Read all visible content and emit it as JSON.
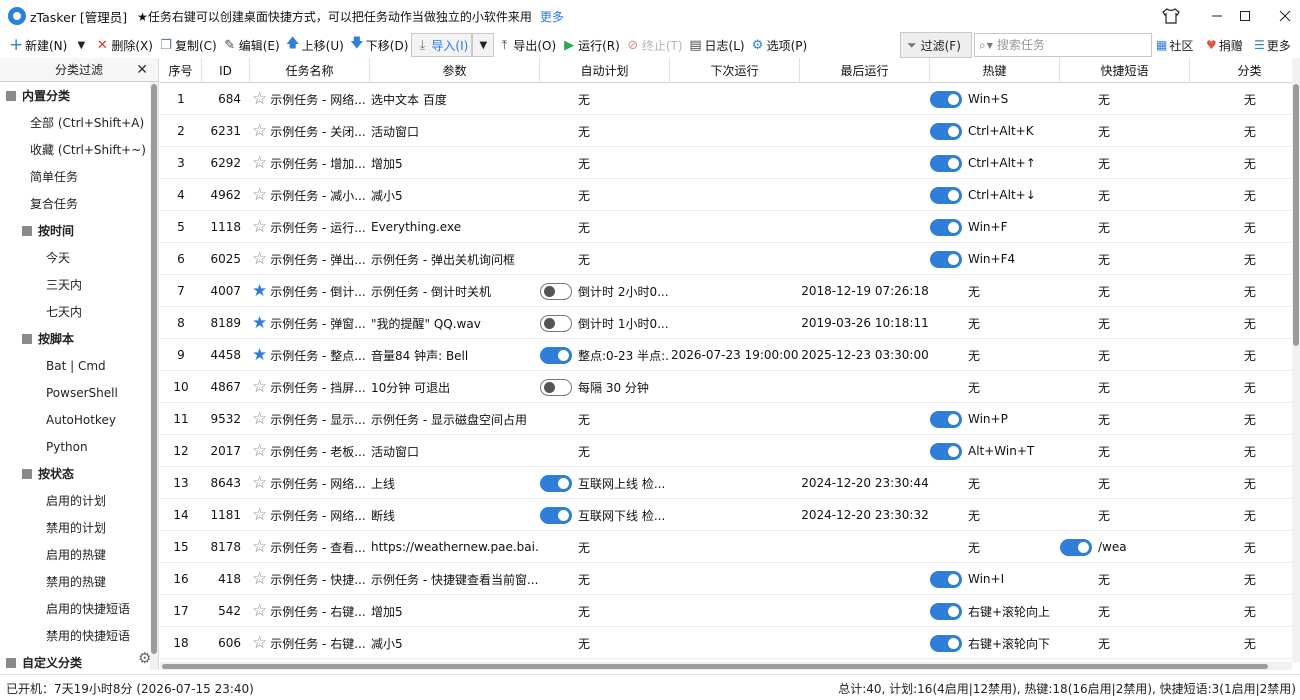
{
  "window": {
    "title": "zTasker [管理员]",
    "tip": "★任务右键可以创建桌面快捷方式，可以把任务动作当做独立的小软件来用",
    "more_link": "更多"
  },
  "toolbar": {
    "new": "新建(N)",
    "delete": "删除(X)",
    "copy": "复制(C)",
    "edit": "编辑(E)",
    "up": "上移(U)",
    "down": "下移(D)",
    "import": "导入(I)",
    "export": "导出(O)",
    "run": "运行(R)",
    "stop": "终止(T)",
    "log": "日志(L)",
    "options": "选项(P)",
    "filter": "过滤(F)",
    "search_placeholder": "搜索任务",
    "community": "社区",
    "donate": "捐赠",
    "more": "更多"
  },
  "sidebar": {
    "header": "分类过滤",
    "groups": [
      {
        "label": "内置分类",
        "items": [
          "全部 (Ctrl+Shift+A)",
          "收藏 (Ctrl+Shift+~)",
          "简单任务",
          "复合任务"
        ]
      },
      {
        "label": "按时间",
        "items": [
          "今天",
          "三天内",
          "七天内"
        ]
      },
      {
        "label": "按脚本",
        "items": [
          "Bat | Cmd",
          "PowserShell",
          "AutoHotkey",
          "Python"
        ]
      },
      {
        "label": "按状态",
        "items": [
          "启用的计划",
          "禁用的计划",
          "启用的热键",
          "禁用的热键",
          "启用的快捷短语",
          "禁用的快捷短语"
        ]
      },
      {
        "label": "自定义分类",
        "items": []
      }
    ]
  },
  "table": {
    "columns": [
      "序号",
      "ID",
      "任务名称",
      "参数",
      "自动计划",
      "下次运行",
      "最后运行",
      "热键",
      "快捷短语",
      "分类"
    ],
    "rows": [
      {
        "no": "1",
        "id": "684",
        "star": false,
        "name": "示例任务 - 网络...",
        "param": "选中文本 百度",
        "plan_toggle": null,
        "plan": "无",
        "next": "",
        "last": "",
        "hotkey_toggle": true,
        "hotkey": "Win+S",
        "phrase_toggle": null,
        "phrase": "无",
        "category": "无"
      },
      {
        "no": "2",
        "id": "6231",
        "star": false,
        "name": "示例任务 - 关闭...",
        "param": "活动窗口",
        "plan_toggle": null,
        "plan": "无",
        "next": "",
        "last": "",
        "hotkey_toggle": true,
        "hotkey": "Ctrl+Alt+K",
        "phrase_toggle": null,
        "phrase": "无",
        "category": "无"
      },
      {
        "no": "3",
        "id": "6292",
        "star": false,
        "name": "示例任务 - 增加...",
        "param": "增加5",
        "plan_toggle": null,
        "plan": "无",
        "next": "",
        "last": "",
        "hotkey_toggle": true,
        "hotkey": "Ctrl+Alt+↑",
        "phrase_toggle": null,
        "phrase": "无",
        "category": "无"
      },
      {
        "no": "4",
        "id": "4962",
        "star": false,
        "name": "示例任务 - 减小...",
        "param": "减小5",
        "plan_toggle": null,
        "plan": "无",
        "next": "",
        "last": "",
        "hotkey_toggle": true,
        "hotkey": "Ctrl+Alt+↓",
        "phrase_toggle": null,
        "phrase": "无",
        "category": "无"
      },
      {
        "no": "5",
        "id": "1118",
        "star": false,
        "name": "示例任务 - 运行...",
        "param": "Everything.exe",
        "plan_toggle": null,
        "plan": "无",
        "next": "",
        "last": "",
        "hotkey_toggle": true,
        "hotkey": "Win+F",
        "phrase_toggle": null,
        "phrase": "无",
        "category": "无"
      },
      {
        "no": "6",
        "id": "6025",
        "star": false,
        "name": "示例任务 - 弹出...",
        "param": "示例任务 - 弹出关机询问框",
        "plan_toggle": null,
        "plan": "无",
        "next": "",
        "last": "",
        "hotkey_toggle": true,
        "hotkey": "Win+F4",
        "phrase_toggle": null,
        "phrase": "无",
        "category": "无"
      },
      {
        "no": "7",
        "id": "4007",
        "star": true,
        "name": "示例任务 - 倒计...",
        "param": "示例任务 - 倒计时关机",
        "plan_toggle": false,
        "plan": "倒计时 2小时0...",
        "next": "",
        "last": "2018-12-19 07:26:18",
        "hotkey_toggle": null,
        "hotkey": "无",
        "phrase_toggle": null,
        "phrase": "无",
        "category": "无"
      },
      {
        "no": "8",
        "id": "8189",
        "star": true,
        "name": "示例任务 - 弹窗...",
        "param": "\"我的提醒\" QQ.wav",
        "plan_toggle": false,
        "plan": "倒计时 1小时0...",
        "next": "",
        "last": "2019-03-26 10:18:11",
        "hotkey_toggle": null,
        "hotkey": "无",
        "phrase_toggle": null,
        "phrase": "无",
        "category": "无"
      },
      {
        "no": "9",
        "id": "4458",
        "star": true,
        "name": "示例任务 - 整点...",
        "param": "音量84 钟声: Bell",
        "plan_toggle": true,
        "plan": "整点:0-23 半点:...",
        "next": "2026-07-23 19:00:00...",
        "last": "2025-12-23 03:30:00",
        "hotkey_toggle": null,
        "hotkey": "无",
        "phrase_toggle": null,
        "phrase": "无",
        "category": "无"
      },
      {
        "no": "10",
        "id": "4867",
        "star": false,
        "name": "示例任务 - 挡屏...",
        "param": "10分钟 可退出",
        "plan_toggle": false,
        "plan": "每隔 30 分钟",
        "next": "",
        "last": "",
        "hotkey_toggle": null,
        "hotkey": "无",
        "phrase_toggle": null,
        "phrase": "无",
        "category": "无"
      },
      {
        "no": "11",
        "id": "9532",
        "star": false,
        "name": "示例任务 - 显示...",
        "param": "示例任务 - 显示磁盘空间占用",
        "plan_toggle": null,
        "plan": "无",
        "next": "",
        "last": "",
        "hotkey_toggle": true,
        "hotkey": "Win+P",
        "phrase_toggle": null,
        "phrase": "无",
        "category": "无"
      },
      {
        "no": "12",
        "id": "2017",
        "star": false,
        "name": "示例任务 - 老板...",
        "param": "活动窗口",
        "plan_toggle": null,
        "plan": "无",
        "next": "",
        "last": "",
        "hotkey_toggle": true,
        "hotkey": "Alt+Win+T",
        "phrase_toggle": null,
        "phrase": "无",
        "category": "无"
      },
      {
        "no": "13",
        "id": "8643",
        "star": false,
        "name": "示例任务 - 网络...",
        "param": "上线",
        "plan_toggle": true,
        "plan": "互联网上线 检...",
        "next": "",
        "last": "2024-12-20 23:30:44",
        "hotkey_toggle": null,
        "hotkey": "无",
        "phrase_toggle": null,
        "phrase": "无",
        "category": "无"
      },
      {
        "no": "14",
        "id": "1181",
        "star": false,
        "name": "示例任务 - 网络...",
        "param": "断线",
        "plan_toggle": true,
        "plan": "互联网下线 检...",
        "next": "",
        "last": "2024-12-20 23:30:32",
        "hotkey_toggle": null,
        "hotkey": "无",
        "phrase_toggle": null,
        "phrase": "无",
        "category": "无"
      },
      {
        "no": "15",
        "id": "8178",
        "star": false,
        "name": "示例任务 - 查看...",
        "param": "https://weathernew.pae.bai...",
        "plan_toggle": null,
        "plan": "无",
        "next": "",
        "last": "",
        "hotkey_toggle": null,
        "hotkey": "无",
        "phrase_toggle": true,
        "phrase": "/wea",
        "category": "无"
      },
      {
        "no": "16",
        "id": "418",
        "star": false,
        "name": "示例任务 - 快捷...",
        "param": "示例任务 - 快捷键查看当前窗...",
        "plan_toggle": null,
        "plan": "无",
        "next": "",
        "last": "",
        "hotkey_toggle": true,
        "hotkey": "Win+I",
        "phrase_toggle": null,
        "phrase": "无",
        "category": "无"
      },
      {
        "no": "17",
        "id": "542",
        "star": false,
        "name": "示例任务 - 右键...",
        "param": "增加5",
        "plan_toggle": null,
        "plan": "无",
        "next": "",
        "last": "",
        "hotkey_toggle": true,
        "hotkey": "右键+滚轮向上",
        "phrase_toggle": null,
        "phrase": "无",
        "category": "无"
      },
      {
        "no": "18",
        "id": "606",
        "star": false,
        "name": "示例任务 - 右键...",
        "param": "减小5",
        "plan_toggle": null,
        "plan": "无",
        "next": "",
        "last": "",
        "hotkey_toggle": true,
        "hotkey": "右键+滚轮向下",
        "phrase_toggle": null,
        "phrase": "无",
        "category": "无"
      }
    ]
  },
  "status": {
    "uptime": "已开机：7天19小时8分 (2026-07-15 23:40)",
    "summary": "总计:40, 计划:16(4启用|12禁用), 热键:18(16启用|2禁用), 快捷短语:3(1启用|2禁用)"
  },
  "colors": {
    "accent": "#2f7fd8",
    "delete": "#d9342b",
    "run": "#2fa84f",
    "donate": "#e0533d"
  }
}
